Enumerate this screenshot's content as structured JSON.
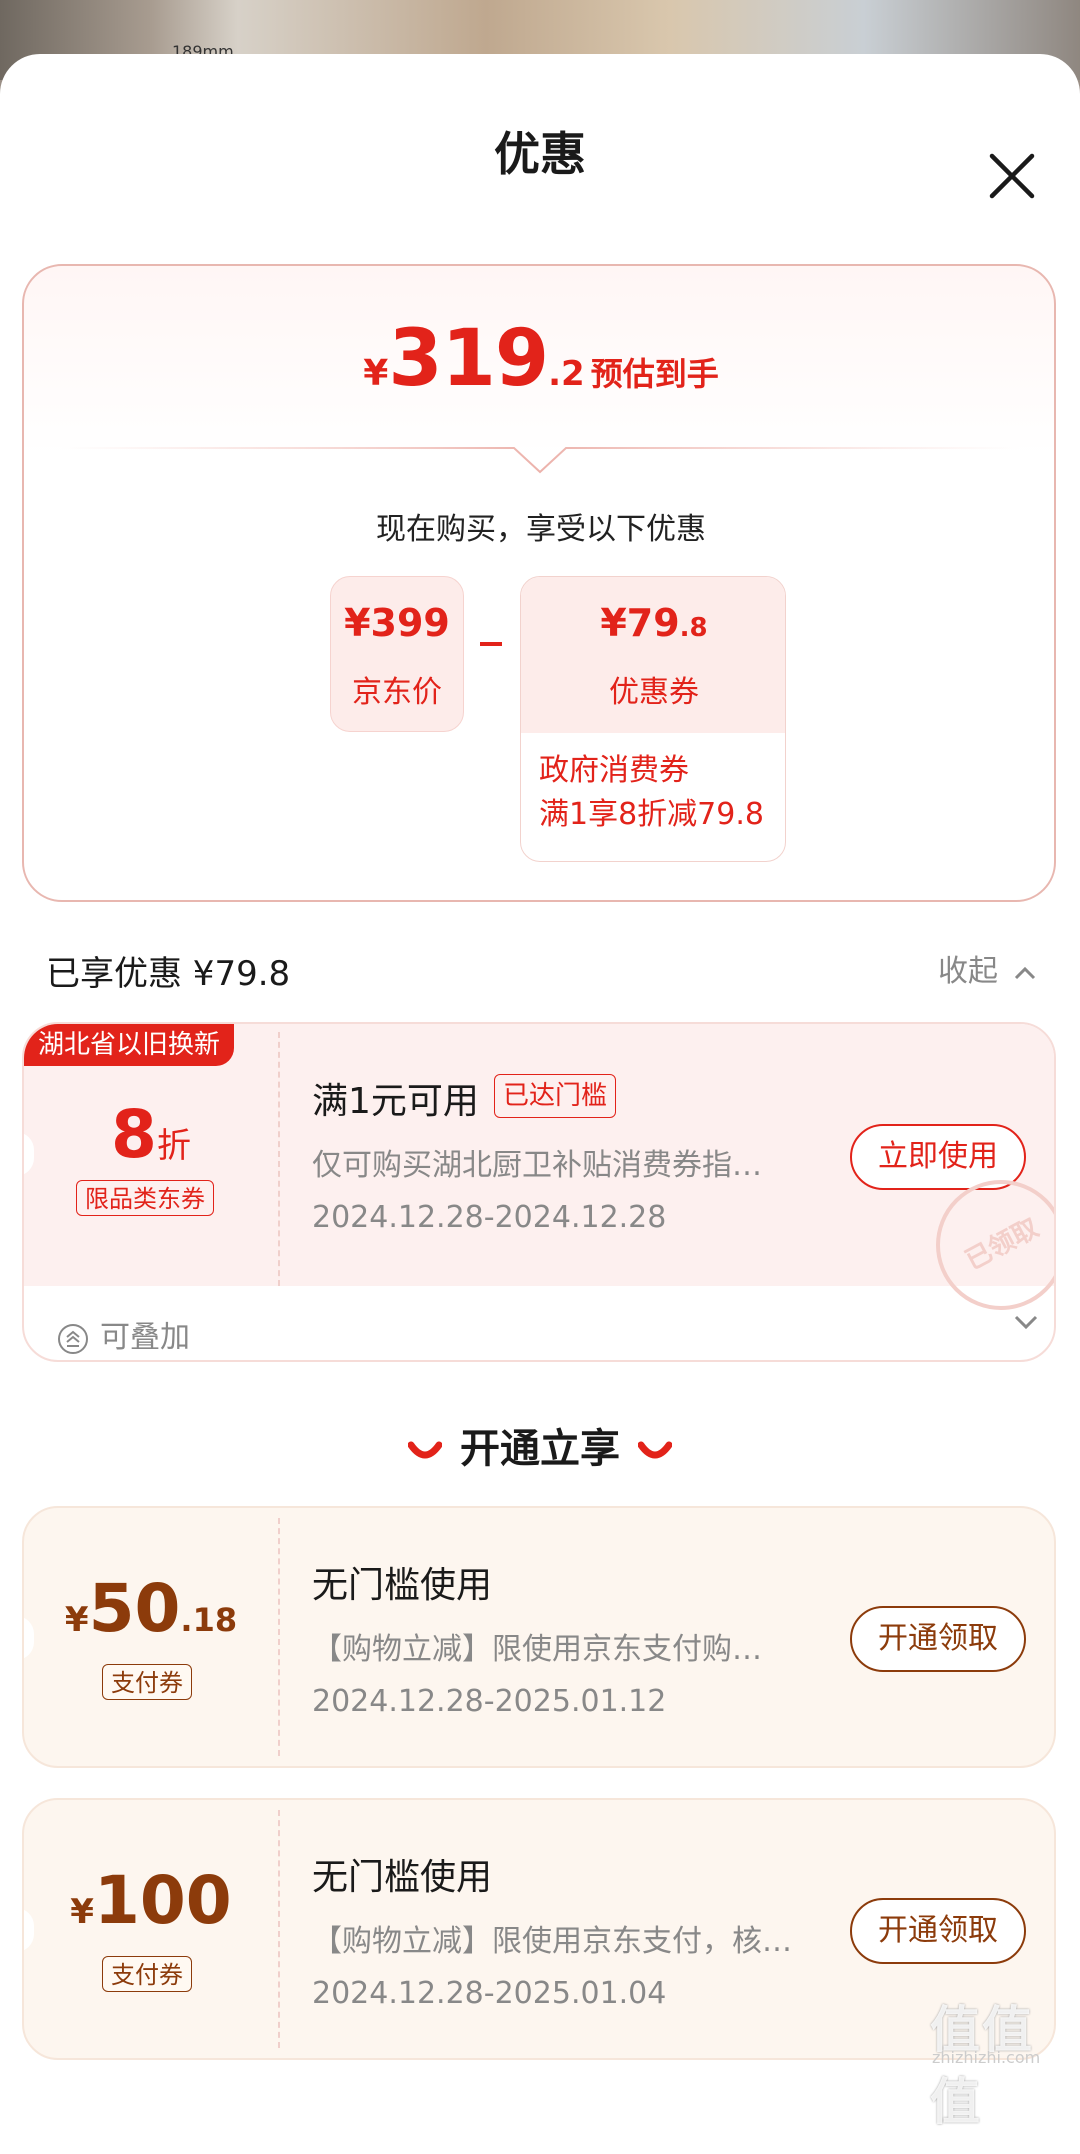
{
  "background": {
    "dimension_text": "189mm"
  },
  "sheet": {
    "title": "优惠"
  },
  "summary": {
    "currency": "¥",
    "est_int": "319",
    "est_dec": ".2",
    "est_label": "预估到手",
    "buy_now_text": "现在购买，享受以下优惠",
    "jd_price": "¥399",
    "jd_price_label": "京东价",
    "coupon_value_main": "¥79",
    "coupon_value_dec": ".8",
    "coupon_label": "优惠券",
    "coupon_sub_line1": "政府消费券",
    "coupon_sub_line2": "满1享8折减79.8"
  },
  "enjoyed": {
    "text": "已享优惠 ¥79.8",
    "collapse_label": "收起"
  },
  "coupon1": {
    "badge": "湖北省以旧换新",
    "value": "8",
    "unit": "折",
    "tag": "限品类东券",
    "title": "满1元可用",
    "threshold_tag": "已达门槛",
    "desc": "仅可购买湖北厨卫补贴消费券指…",
    "date": "2024.12.28-2024.12.28",
    "button": "立即使用",
    "stamp": "已领取",
    "stack_label": "可叠加"
  },
  "section": {
    "title": "开通立享"
  },
  "coupon2": {
    "currency": "¥",
    "value": "50",
    "dec": ".18",
    "tag": "支付券",
    "title": "无门槛使用",
    "desc": "【购物立减】限使用京东支付购…",
    "date": "2024.12.28-2025.01.12",
    "button": "开通领取"
  },
  "coupon3": {
    "currency": "¥",
    "value": "100",
    "tag": "支付券",
    "title": "无门槛使用",
    "desc": "【购物立减】限使用京东支付，核…",
    "date": "2024.12.28-2025.01.04",
    "button": "开通领取"
  },
  "watermark": {
    "text": "值值值",
    "sub": "zhizhizhi.com"
  },
  "colors": {
    "red": "#e2231a",
    "brown": "#8c3b0b"
  }
}
